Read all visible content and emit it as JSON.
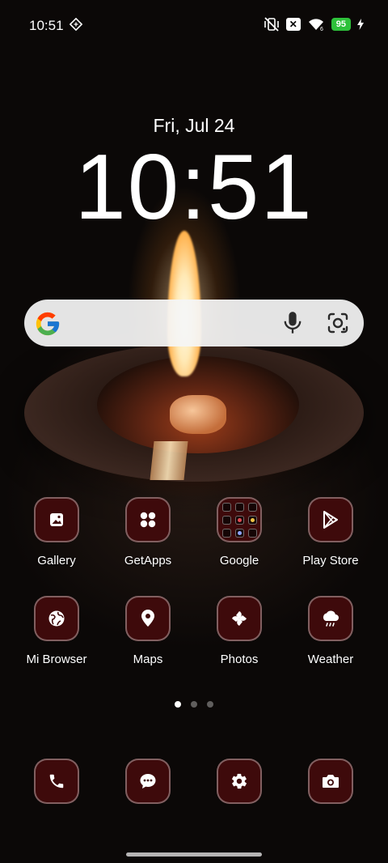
{
  "status_bar": {
    "time": "10:51",
    "battery": "95",
    "x_badge": "✕"
  },
  "clock_widget": {
    "date": "Fri, Jul 24",
    "time": "10:51"
  },
  "search": {
    "logo": "G"
  },
  "apps": [
    {
      "label": "Gallery",
      "icon": "gallery-icon"
    },
    {
      "label": "GetApps",
      "icon": "getapps-icon"
    },
    {
      "label": "Google",
      "icon": "google-folder-icon"
    },
    {
      "label": "Play Store",
      "icon": "play-store-icon"
    },
    {
      "label": "Mi Browser",
      "icon": "globe-icon"
    },
    {
      "label": "Maps",
      "icon": "map-pin-icon"
    },
    {
      "label": "Photos",
      "icon": "pinwheel-icon"
    },
    {
      "label": "Weather",
      "icon": "cloud-icon"
    }
  ],
  "dock": [
    {
      "name": "phone",
      "icon": "phone-icon"
    },
    {
      "name": "messages",
      "icon": "chat-icon"
    },
    {
      "name": "settings",
      "icon": "gear-icon"
    },
    {
      "name": "camera",
      "icon": "camera-icon"
    }
  ],
  "page_indicator": {
    "count": 3,
    "active": 1
  },
  "colors": {
    "icon_bg": "#3e0a0b",
    "battery_green": "#2ec13b"
  }
}
